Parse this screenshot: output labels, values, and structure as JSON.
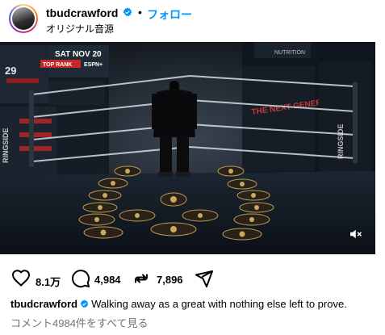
{
  "header": {
    "username": "tbudcrawford",
    "separator": "•",
    "follow_label": "フォロー",
    "audio_label": "オリジナル音源"
  },
  "media": {
    "poster_left_top": "SAT NOV 20",
    "poster_left_brand": "TOP RANK",
    "poster_left_network": "ESPN+",
    "poster_left_side": "RINGSIDE",
    "poster_right_banner": "THE NEXT GENERATION",
    "poster_right_side": "RINGSIDE",
    "poster_right_top": "NUTRITION"
  },
  "actions": {
    "likes": "8.1万",
    "comments": "4,984",
    "reposts": "7,896"
  },
  "caption": {
    "username": "tbudcrawford",
    "text": "Walking away as a great with nothing else left to prove."
  },
  "comments_link": "コメント4984件をすべて見る",
  "colors": {
    "link_blue": "#0095f6",
    "verified_blue": "#0095f6",
    "muted_text": "#737373"
  }
}
